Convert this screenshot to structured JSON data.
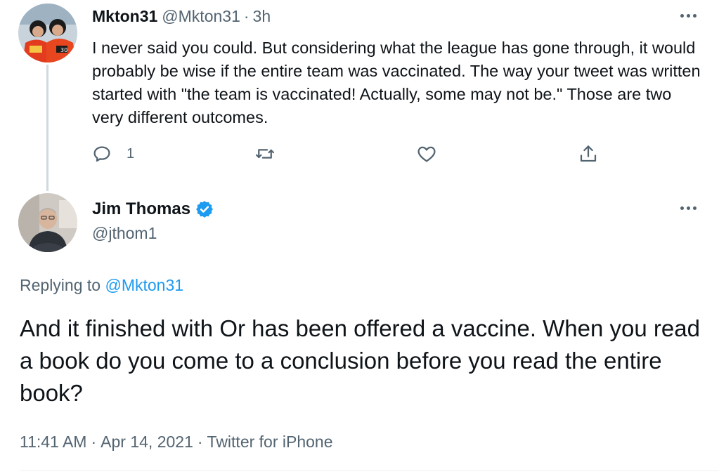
{
  "tweet1": {
    "avatar_icon": "profile-photo",
    "display_name": "Mkton31",
    "handle": "@Mkton31",
    "separator": "·",
    "time": "3h",
    "body": "I never said you could. But considering what the league has gone through, it would probably be wise if the entire team was vaccinated. The way your tweet was written started with \"the team is vaccinated! Actually, some may not be.\" Those are two very different outcomes.",
    "actions": {
      "reply_icon": "reply-icon",
      "reply_count": "1",
      "retweet_icon": "retweet-icon",
      "like_icon": "heart-icon",
      "share_icon": "share-icon"
    },
    "more_icon": "more-options-icon"
  },
  "tweet2": {
    "avatar_icon": "profile-photo",
    "display_name": "Jim Thomas",
    "verified_icon": "verified-badge-icon",
    "handle": "@jthom1",
    "replying_prefix": "Replying to ",
    "replying_handle": "@Mkton31",
    "body": "And it finished with Or has been offered a vaccine. When you read a book do you come to a conclusion before you read the entire book?",
    "time": "11:41 AM",
    "separator": "·",
    "date": "Apr 14, 2021",
    "source": "Twitter for iPhone",
    "more_icon": "more-options-icon"
  },
  "colors": {
    "text_primary": "#0f1419",
    "text_secondary": "#536471",
    "accent": "#1d9bf0",
    "thread_line": "#cfd9de"
  }
}
